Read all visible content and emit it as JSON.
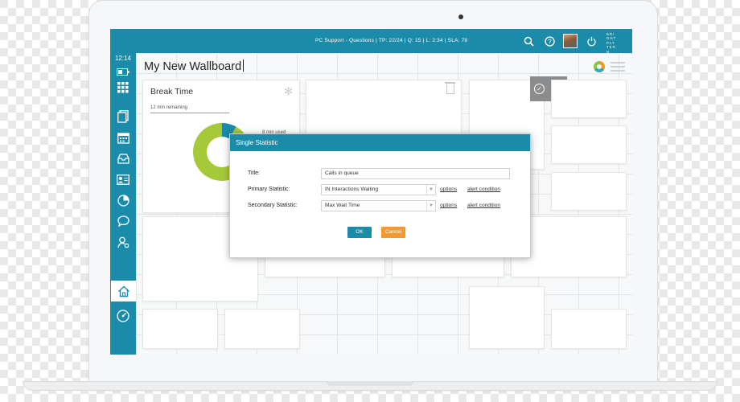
{
  "topbar": {
    "status_text": "PC Support - Questions | TP: 22/24  |  Q: 15  |  L: 2:34  |  SLA: 78",
    "brand_lines": [
      "BRI",
      "GHT",
      "PAT",
      "TER",
      "N"
    ]
  },
  "sidebar": {
    "clock": "12:14",
    "icons": [
      "battery-icon",
      "grid-icon",
      "documents-icon",
      "calendar-icon",
      "inbox-icon",
      "contact-card-icon",
      "pie-chart-icon",
      "chat-icon",
      "user-settings-icon",
      "home-icon",
      "dashboard-gauge-icon"
    ],
    "active": "home-icon"
  },
  "wallboard": {
    "title": "My New Wallboard"
  },
  "tile_break_time": {
    "title": "Break Time",
    "remaining": "12 min remaining",
    "used": "8 min used"
  },
  "dialog": {
    "header": "Single Statistic",
    "title_label": "Title:",
    "title_value": "Calls in queue",
    "primary_label": "Primary Statistic:",
    "primary_value": "IN Interactions Waiting",
    "secondary_label": "Secondary Statistic:",
    "secondary_value": "Max Wait Time",
    "options_label": "options",
    "alert_label": "alert condition",
    "ok_label": "OK",
    "cancel_label": "Cancel"
  },
  "colors": {
    "accent": "#1a8ba9",
    "ring_green": "#a6c93a",
    "cancel_orange": "#f29a31"
  }
}
